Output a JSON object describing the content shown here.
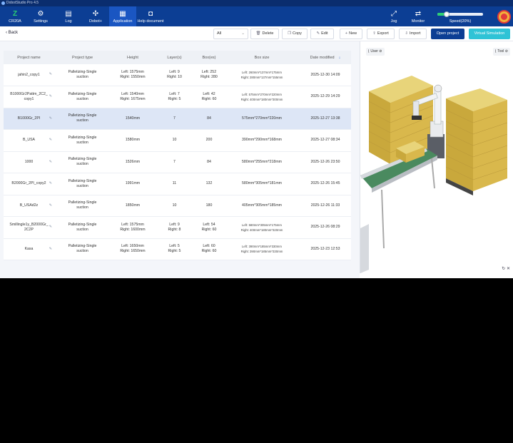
{
  "title_bar": {
    "app_title": "DobotStudio Pro 4.5"
  },
  "nav": {
    "robot_label": "CR20A",
    "items": [
      {
        "label": "Settings",
        "icon": "gear-icon"
      },
      {
        "label": "Log",
        "icon": "log-icon"
      },
      {
        "label": "Dobot+",
        "icon": "puzzle-icon"
      },
      {
        "label": "Application",
        "icon": "application-icon"
      },
      {
        "label": "Help document",
        "icon": "help-icon"
      }
    ],
    "right_items": [
      {
        "label": "Jog",
        "icon": "jog-icon"
      },
      {
        "label": "Monitor",
        "icon": "monitor-icon"
      }
    ],
    "speed_label": "Speed(20%)",
    "speed_knob_text": "20",
    "speed_fraction": 0.2
  },
  "toolbar": {
    "back_label": "Back",
    "filter_value": "All",
    "delete_label": "Delete",
    "copy_label": "Copy",
    "edit_label": "Edit",
    "new_label": "New",
    "export_label": "Export",
    "import_label": "Import",
    "open_label": "Open project",
    "simulation_label": "Virtual Simulation"
  },
  "table": {
    "headers": [
      "Project name",
      "Project type",
      "Height",
      "Layer(s)",
      "Box(es)",
      "Box size",
      "Date modified"
    ],
    "rows": [
      {
        "name": "jahin2_copy1",
        "type": [
          "Palletizing-Single",
          "suction"
        ],
        "height": [
          "Left:  1575mm",
          "Right:  1550mm"
        ],
        "layers": [
          "Left:  9",
          "Right:  10"
        ],
        "boxes": [
          "Left:  252",
          "Right:  280"
        ],
        "boxsize": [
          "Left:  260mm*137mm*175mm",
          "Right:  280mm*137mm*155mm"
        ],
        "date": "2025-12-30 14:09"
      },
      {
        "name": [
          "B1000Gr2Pattm_2C2_",
          "copy1"
        ],
        "type": [
          "Palletizing-Single",
          "suction"
        ],
        "height": [
          "Left:  1540mm",
          "Right:  1675mm"
        ],
        "layers": [
          "Left:  7",
          "Right:  5"
        ],
        "boxes": [
          "Left:  42",
          "Right:  60"
        ],
        "boxsize": [
          "Left:  575mm*270mm*220mm",
          "Right:  400mm*180mm*300mm"
        ],
        "date": "2025-12-29 14:29"
      },
      {
        "name": "B1000Gr_2PI",
        "type": [
          "Palletizing-Single",
          "suction"
        ],
        "height": [
          "1540mm"
        ],
        "layers": [
          "7"
        ],
        "boxes": [
          "84"
        ],
        "boxsize": [
          "575mm*270mm*220mm"
        ],
        "date": "2025-12-27 13:38"
      },
      {
        "name": "B_USA",
        "type": [
          "Palletizing-Single",
          "suction"
        ],
        "height": [
          "1580mm"
        ],
        "layers": [
          "10"
        ],
        "boxes": [
          "200"
        ],
        "boxsize": [
          "390mm*290mm*168mm"
        ],
        "date": "2025-12-27 08:34"
      },
      {
        "name": "1000",
        "type": [
          "Palletizing-Single",
          "suction"
        ],
        "height": [
          "1526mm"
        ],
        "layers": [
          "7"
        ],
        "boxes": [
          "84"
        ],
        "boxsize": [
          "580mm*255mm*218mm"
        ],
        "date": "2025-12-26 23:50"
      },
      {
        "name": "B2000Gr_2PI_copy2",
        "type": [
          "Palletizing-Single",
          "suction"
        ],
        "height": [
          "1991mm"
        ],
        "layers": [
          "11"
        ],
        "boxes": [
          "132"
        ],
        "boxsize": [
          "580mm*305mm*181mm"
        ],
        "date": "2025-12-26 15:45"
      },
      {
        "name": "B_USAd2z",
        "type": [
          "Palletizing-Single",
          "suction"
        ],
        "height": [
          "1850mm"
        ],
        "layers": [
          "10"
        ],
        "boxes": [
          "180"
        ],
        "boxsize": [
          "405mm*305mm*185mm"
        ],
        "date": "2025-12-26 11:33"
      },
      {
        "name": [
          "Smillingle1y_B2000Gr_",
          "2C2P"
        ],
        "type": [
          "Palletizing-Single",
          "suction"
        ],
        "height": [
          "Left:  1575mm",
          "Right:  1600mm"
        ],
        "layers": [
          "Left:  9",
          "Right:  8"
        ],
        "boxes": [
          "Left:  54",
          "Right:  60"
        ],
        "boxsize": [
          "Left:  580mm*305mm*175mm",
          "Right:  400mm*180mm*320mm"
        ],
        "date": "2025-12-26 08:29"
      },
      {
        "name": "Kasa",
        "type": [
          "Palletizing-Single",
          "suction"
        ],
        "height": [
          "Left:  1650mm",
          "Right:  1650mm"
        ],
        "layers": [
          "Left:  5",
          "Right:  5"
        ],
        "boxes": [
          "Left:  60",
          "Right:  60"
        ],
        "boxsize": [
          "Left:  390mm*185mm*330mm",
          "Right:  390mm*185mm*330mm"
        ],
        "date": "2025-12-23 12:53"
      }
    ]
  },
  "viewport": {
    "user_label": "User",
    "tool_label": "Tool",
    "footer_icons": [
      "refresh-icon",
      "close-icon"
    ]
  },
  "colors": {
    "nav_bg": "#0c3e94",
    "primary": "#0c3e94",
    "accent": "#2fc3d6",
    "box": "#d9b84c",
    "conveyor": "#4a8a5f"
  }
}
